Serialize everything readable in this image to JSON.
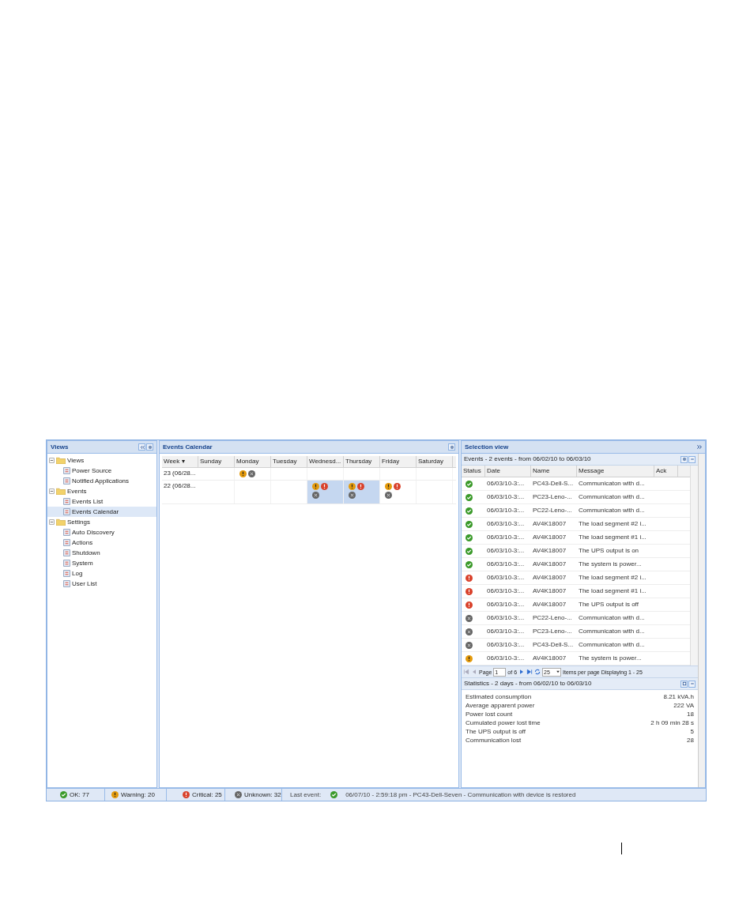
{
  "sidebar": {
    "title": "Views",
    "tree": [
      {
        "label": "Views",
        "expanded": true,
        "selected": false,
        "children": [
          {
            "label": "Power Source",
            "selected": false
          },
          {
            "label": "Notified Applications",
            "selected": false
          }
        ]
      },
      {
        "label": "Events",
        "expanded": true,
        "selected": false,
        "children": [
          {
            "label": "Events List",
            "selected": false
          },
          {
            "label": "Events Calendar",
            "selected": true
          }
        ]
      },
      {
        "label": "Settings",
        "expanded": true,
        "selected": false,
        "children": [
          {
            "label": "Auto Discovery",
            "selected": false
          },
          {
            "label": "Actions",
            "selected": false
          },
          {
            "label": "Shutdown",
            "selected": false
          },
          {
            "label": "System",
            "selected": false
          },
          {
            "label": "Log",
            "selected": false
          },
          {
            "label": "User List",
            "selected": false
          }
        ]
      }
    ]
  },
  "calendar": {
    "title": "Events Calendar",
    "columns": [
      "Week ▾",
      "Sunday",
      "Monday",
      "Tuesday",
      "Wednesd...",
      "Thursday",
      "Friday",
      "Saturday"
    ],
    "rows": [
      {
        "week": "23 (06/28...",
        "days": [
          {
            "selected": false
          },
          {
            "selected": false,
            "events": [
              {
                "kind": "warning"
              },
              {
                "kind": "unknown"
              }
            ]
          },
          {
            "selected": false
          },
          {
            "selected": false
          },
          {
            "selected": false
          },
          {
            "selected": false
          },
          {
            "selected": false
          }
        ]
      },
      {
        "week": "22 (06/28...",
        "days": [
          {
            "selected": false
          },
          {
            "selected": false
          },
          {
            "selected": false
          },
          {
            "selected": true,
            "events": [
              {
                "kind": "warning"
              },
              {
                "kind": "critical"
              },
              {
                "kind": "unknown"
              }
            ]
          },
          {
            "selected": true,
            "events": [
              {
                "kind": "warning"
              },
              {
                "kind": "critical"
              },
              {
                "kind": "unknown"
              }
            ]
          },
          {
            "selected": false,
            "events": [
              {
                "kind": "warning"
              },
              {
                "kind": "critical"
              },
              {
                "kind": "unknown"
              }
            ]
          },
          {
            "selected": false
          }
        ]
      }
    ]
  },
  "selection": {
    "title": "Selection view",
    "events": {
      "title": "Events - 2 events - from 06/02/10 to 06/03/10",
      "columns": [
        "Status",
        "Date",
        "Name",
        "Message",
        "Ack"
      ],
      "rows": [
        {
          "kind": "ok",
          "date": "06/03/10-3:...",
          "name": "PC43-Dell-S...",
          "message": "Communicaton with d..."
        },
        {
          "kind": "ok",
          "date": "06/03/10-3:...",
          "name": "PC23-Leno-...",
          "message": "Communicaton with d..."
        },
        {
          "kind": "ok",
          "date": "06/03/10-3:...",
          "name": "PC22-Leno-...",
          "message": "Communicaton with d..."
        },
        {
          "kind": "ok",
          "date": "06/03/10-3:...",
          "name": "AV4K18007",
          "message": "The load segment #2 i..."
        },
        {
          "kind": "ok",
          "date": "06/03/10-3:...",
          "name": "AV4K18007",
          "message": "The load segment #1 i..."
        },
        {
          "kind": "ok",
          "date": "06/03/10-3:...",
          "name": "AV4K18007",
          "message": "The UPS output is on"
        },
        {
          "kind": "ok",
          "date": "06/03/10-3:...",
          "name": "AV4K18007",
          "message": "The system is power..."
        },
        {
          "kind": "critical",
          "date": "06/03/10-3:...",
          "name": "AV4K18007",
          "message": "The load segment #2 i..."
        },
        {
          "kind": "critical",
          "date": "06/03/10-3:...",
          "name": "AV4K18007",
          "message": "The load segment #1 i..."
        },
        {
          "kind": "critical",
          "date": "06/03/10-3:...",
          "name": "AV4K18007",
          "message": "The UPS output is off"
        },
        {
          "kind": "unknown",
          "date": "06/03/10-3:...",
          "name": "PC22-Leno-...",
          "message": "Communicaton with d..."
        },
        {
          "kind": "unknown",
          "date": "06/03/10-3:...",
          "name": "PC23-Leno-...",
          "message": "Communicaton with d..."
        },
        {
          "kind": "unknown",
          "date": "06/03/10-3:...",
          "name": "PC43-Dell-S...",
          "message": "Communicaton with d..."
        },
        {
          "kind": "warning",
          "date": "06/03/10-3:...",
          "name": "AV4K18007",
          "message": "The system is power..."
        }
      ],
      "pager": {
        "page_label": "Page",
        "page": "1",
        "of": "of 6",
        "page_size": "25",
        "items_label": "Items per page",
        "displaying": "Displaying 1 - 25"
      }
    },
    "statistics": {
      "title": "Statistics - 2 days - from 06/02/10 to 06/03/10",
      "rows": [
        {
          "label": "Estimated consumption",
          "value": "8.21 kVA.h"
        },
        {
          "label": "Average apparent power",
          "value": "222 VA"
        },
        {
          "label": "Power lost count",
          "value": "18"
        },
        {
          "label": "Cumulated power lost time",
          "value": "2 h 09 min 28 s"
        },
        {
          "label": "The UPS output is off",
          "value": "5"
        },
        {
          "label": "Communication lost",
          "value": "28"
        }
      ]
    }
  },
  "status_bar": {
    "counts": [
      {
        "kind": "ok",
        "text": "OK: 77"
      },
      {
        "kind": "warning",
        "text": "Warning: 20"
      },
      {
        "kind": "critical",
        "text": "Critical: 25"
      },
      {
        "kind": "unknown",
        "text": "Unknown: 32"
      }
    ],
    "last_event": {
      "label": "Last event:",
      "kind": "ok",
      "text": "06/07/10 - 2:59:18 pm - PC43-Dell-Seven - Communication with device is restored"
    }
  }
}
